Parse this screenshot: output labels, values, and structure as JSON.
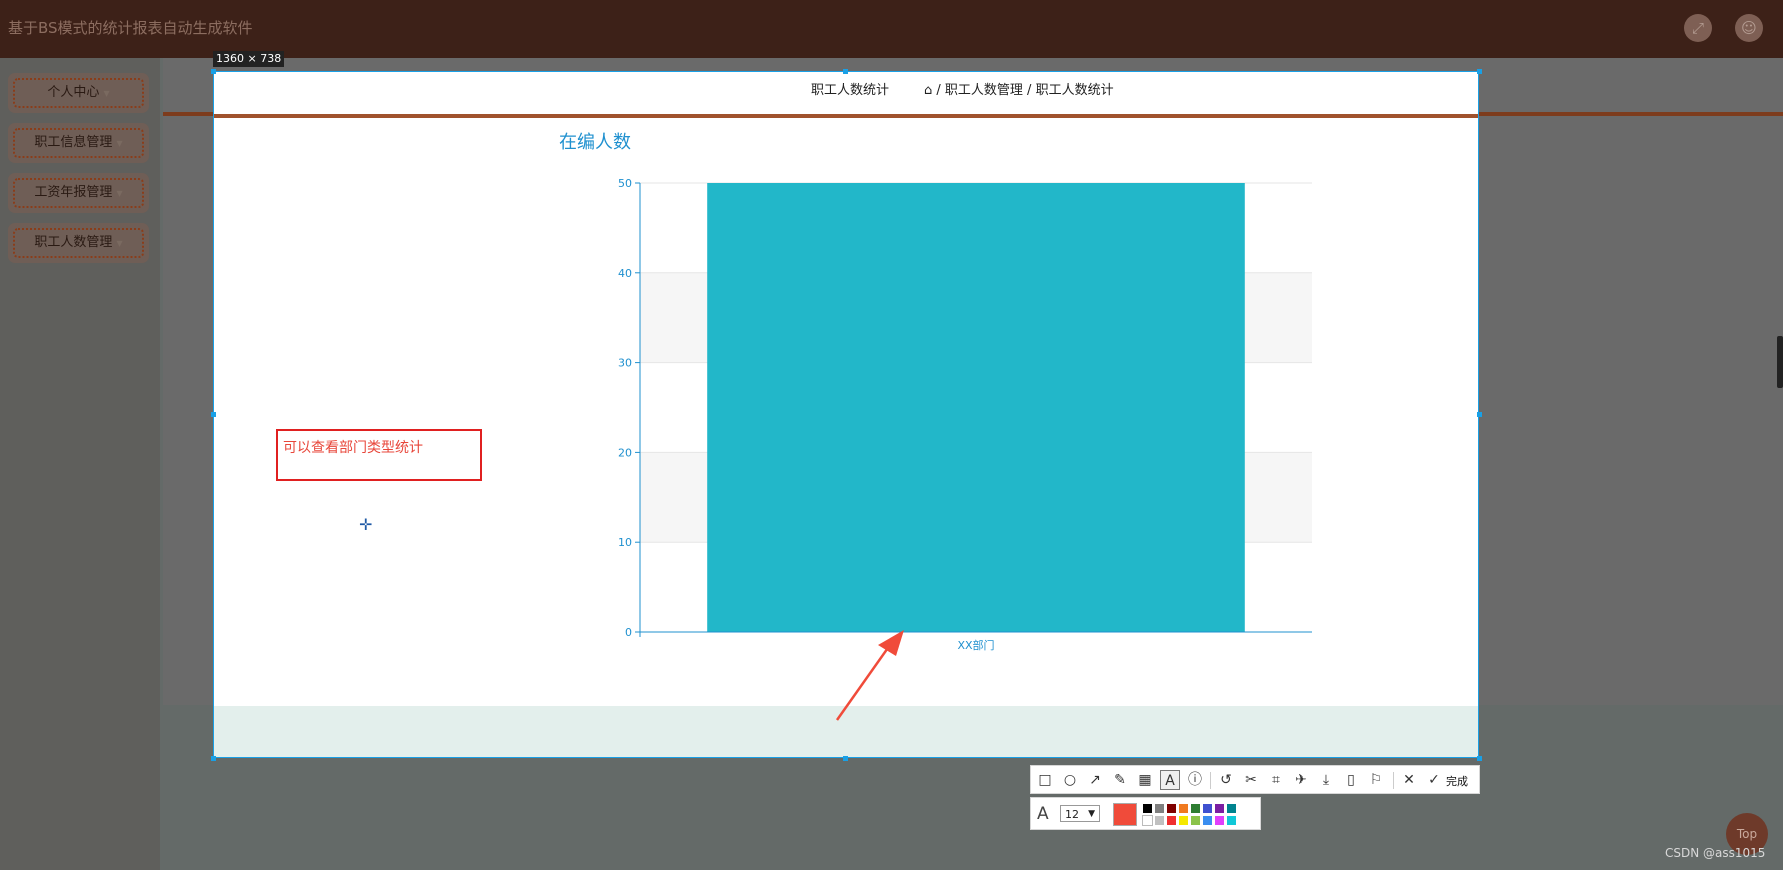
{
  "app": {
    "title": "基于BS模式的统计报表自动生成软件"
  },
  "sidebar": {
    "items": [
      {
        "label": "个人中心"
      },
      {
        "label": "职工信息管理"
      },
      {
        "label": "工资年报管理"
      },
      {
        "label": "职工人数管理"
      }
    ]
  },
  "selection": {
    "size_label": "1360 × 738"
  },
  "page": {
    "title": "职工人数统计",
    "breadcrumb": "/ 职工人数管理 / 职工人数统计"
  },
  "chart_data": {
    "type": "bar",
    "title": "在编人数",
    "categories": [
      "XX部门"
    ],
    "values": [
      50
    ],
    "ylim": [
      0,
      50
    ],
    "yticks": [
      0,
      10,
      20,
      30,
      40,
      50
    ],
    "grid": true,
    "bar_color": "#22b7c9",
    "axis_color": "#1f90cf"
  },
  "annotation": {
    "text": "可以查看部门类型统计",
    "color": "#e02020"
  },
  "screenshot_tool": {
    "done_label": "完成",
    "font_size": "12",
    "current_color": "#f04b3a",
    "palette": [
      "#000000",
      "#808080",
      "#800000",
      "#f07a20",
      "#2e7d32",
      "#3f51d0",
      "#7b1fa2",
      "#00838f",
      "#ffffff",
      "#c0c0c0",
      "#f03030",
      "#f5e800",
      "#8bc34a",
      "#3a8ef0",
      "#e040fb",
      "#10c8d8"
    ]
  },
  "top_button": {
    "label": "Top"
  },
  "watermark": {
    "text": "CSDN @ass1015"
  }
}
